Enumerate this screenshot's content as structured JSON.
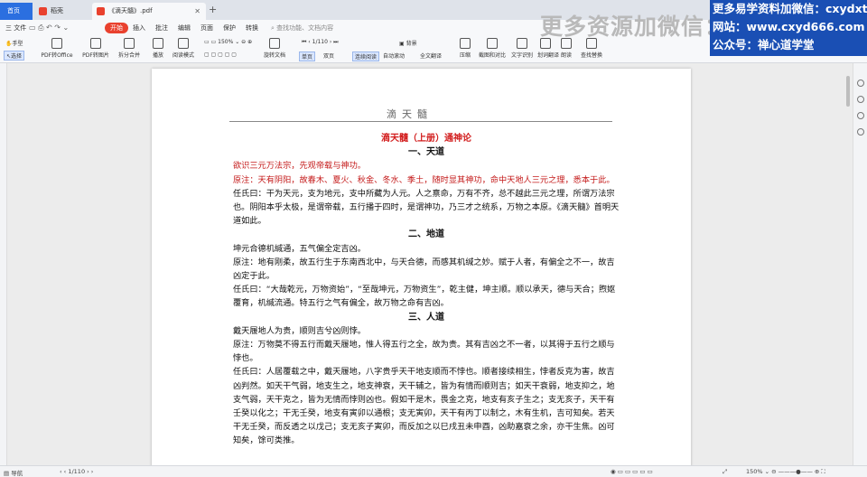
{
  "tabs": [
    {
      "label": "首页"
    },
    {
      "label": "稻壳"
    },
    {
      "label": "《滴天髓》.pdf"
    }
  ],
  "new_tab_symbol": "+",
  "menu": {
    "file": "三 文件",
    "items": [
      "开始",
      "插入",
      "批注",
      "编辑",
      "页面",
      "保护",
      "转换"
    ],
    "search_placeholder": "查找功能、文档内容"
  },
  "ribbon": {
    "hand": "手型",
    "select": "选择",
    "pdf_to_office": "PDF转Office",
    "pdf_to_image": "PDF转图片",
    "split_merge": "拆分合并",
    "play": "播放",
    "read_mode": "阅读模式",
    "zoom": "150%",
    "page_indicator": "1/110",
    "rotate": "旋转文档",
    "single_page": "单页",
    "double_page": "双页",
    "continuous": "连续阅读",
    "auto_scroll": "自动滚动",
    "bg": "背景",
    "full_translate": "全文翻译",
    "compress": "压缩",
    "screenshot_compare": "截图和对比",
    "ocr": "文字识别",
    "translate": "划词翻译",
    "read_aloud": "朗读",
    "find_replace": "查找替换"
  },
  "watermark": {
    "left": "更多资源加微信：",
    "line1": "更多易学资料加微信：cxydxt66",
    "line2": "网站：www.cxyd666.com",
    "line3": "公众号：禅心道学堂"
  },
  "document": {
    "running_head": "滴天髓",
    "chapter_title": "滴天髓（上册）通神论",
    "section1": "一、天道",
    "s1_quote": "欲识三元万法宗，先观帝载与神功。",
    "s1_note": "原注：天有阴阳，故春木、夏火、秋金、冬水、季土，随时显其神功，命中天地人三元之理，悉本于此。",
    "s1_ren": "任氏曰：干为天元，支为地元，支中所藏为人元。人之禀命，万有不齐，总不越此三元之理，所谓万法宗也。阴阳本乎太极，是谓帝载，五行播于四时，是谓神功，乃三才之统系，万物之本原。《滴天髓》首明天道如此。",
    "section2": "二、地道",
    "s2_quote": "坤元合德机缄通，五气偏全定吉凶。",
    "s2_note": "原注：地有刚柔，故五行生于东南西北中，与天合德，而感其机缄之妙。赋于人者，有偏全之不一，故吉凶定于此。",
    "s2_ren": "任氏曰：“大哉乾元，万物资始”，“至哉坤元，万物资生”，乾主健，坤主顺。顺以承天，德与天合；煦妪覆育，机缄流通。特五行之气有偏全，故万物之命有吉凶。",
    "section3": "三、人道",
    "s3_quote": "戴天履地人为贵，顺则吉兮凶则悖。",
    "s3_note": "原注：万物莫不得五行而戴天履地，惟人得五行之全，故为贵。其有吉凶之不一者，以其得于五行之顺与悖也。",
    "s3_ren": "任氏曰：人居覆载之中，戴天履地，八字贵乎天干地支顺而不悖也。顺者接续相生，悖者反克为害，故吉凶判然。如天干气弱，地支生之，地支神衰，天干辅之，皆为有情而顺则吉；如天干衰弱，地支抑之，地支气弱，天干克之，皆为无情而悖则凶也。假如干是木，畏金之克，地支有亥子生之；支无亥子，天干有壬癸以化之；干无壬癸，地支有寅卯以通根；支无寅卯，天干有丙丁以制之，木有生机，吉可知矣。若天干无壬癸，而反透之以戊己；支无亥子寅卯，而反加之以巳戌丑未申酉，凶助嘉衰之余，亦干生焦。凶可知矣，馀可类推。"
  },
  "status": {
    "nav": "导航",
    "page": "1/110",
    "zoom": "150%"
  },
  "colors": {
    "accent": "#e9412e",
    "tab_home": "#2b6fe0",
    "watermark_box": "#1a4fb4",
    "doc_red": "#c41a1a"
  }
}
